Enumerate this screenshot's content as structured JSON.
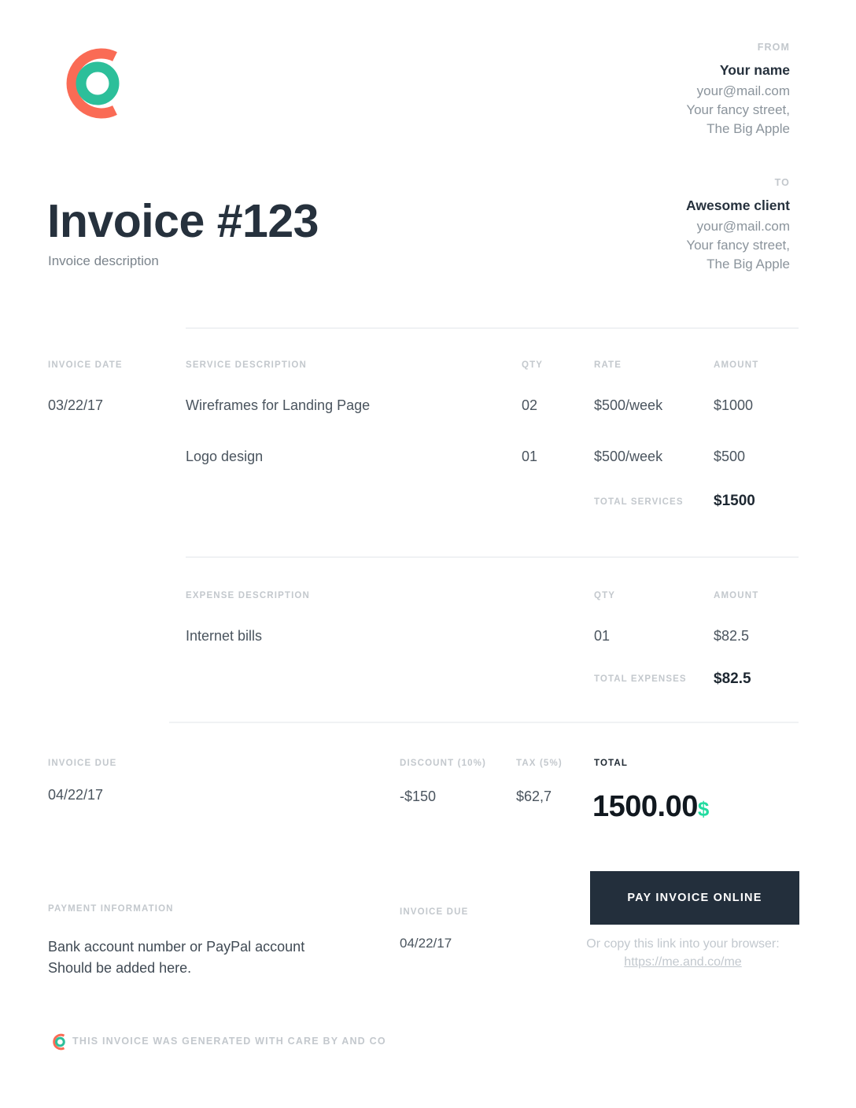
{
  "brand": {
    "logo_icon": "and-co-logo-icon",
    "accent_red": "#fa6b55",
    "accent_teal": "#2cbf9a",
    "currency_teal": "#22dba0",
    "dark": "#232f3c"
  },
  "from": {
    "label": "FROM",
    "name": "Your name",
    "email": "your@mail.com",
    "street": "Your fancy street,",
    "city": "The Big Apple"
  },
  "to": {
    "label": "TO",
    "name": "Awesome client",
    "email": "your@mail.com",
    "street": "Your fancy street,",
    "city": "The Big Apple"
  },
  "header": {
    "title": "Invoice #123",
    "subtitle": "Invoice description"
  },
  "invoice_date": {
    "label": "INVOICE DATE",
    "value": "03/22/17"
  },
  "services": {
    "headers": {
      "description": "SERVICE DESCRIPTION",
      "qty": "QTY",
      "rate": "RATE",
      "amount": "AMOUNT"
    },
    "rows": [
      {
        "description": "Wireframes for Landing Page",
        "qty": "02",
        "rate": "$500/week",
        "amount": "$1000"
      },
      {
        "description": "Logo design",
        "qty": "01",
        "rate": "$500/week",
        "amount": "$500"
      }
    ],
    "total_label": "TOTAL SERVICES",
    "total_value": "$1500"
  },
  "expenses": {
    "headers": {
      "description": "EXPENSE DESCRIPTION",
      "qty": "QTY",
      "amount": "AMOUNT"
    },
    "rows": [
      {
        "description": "Internet bills",
        "qty": "01",
        "amount": "$82.5"
      }
    ],
    "total_label": "TOTAL EXPENSES",
    "total_value": "$82.5"
  },
  "summary": {
    "invoice_due_label": "INVOICE DUE",
    "invoice_due_value": "04/22/17",
    "discount_label": "DISCOUNT (10%)",
    "discount_value": "-$150",
    "tax_label": "TAX (5%)",
    "tax_value": "$62,7",
    "total_label": "TOTAL",
    "total_amount": "1500.00",
    "total_currency": "$"
  },
  "payment": {
    "info_label": "PAYMENT INFORMATION",
    "info_line1": "Bank account number or PayPal account",
    "info_line2": "Should be added here.",
    "due_label": "INVOICE DUE",
    "due_value": "04/22/17",
    "button_label": "PAY INVOICE ONLINE",
    "note_prefix": "Or copy this link into your browser: ",
    "note_link": "https://me.and.co/me"
  },
  "footer": {
    "text": "THIS INVOICE WAS GENERATED WITH CARE BY AND CO",
    "logo_icon": "and-co-logo-icon"
  }
}
